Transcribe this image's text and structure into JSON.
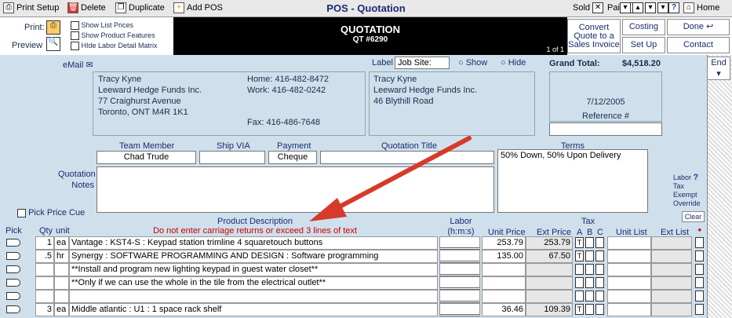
{
  "toolbar": {
    "print_setup": "Print Setup",
    "delete": "Delete",
    "duplicate": "Duplicate",
    "add_pos": "Add POS",
    "title": "POS - Quotation",
    "sold": "Sold",
    "paid": "Paid",
    "home": "Home"
  },
  "header": {
    "print": "Print:",
    "preview": "Preview",
    "show_list_prices": "Show List Prices",
    "show_product_features": "Show Product Features",
    "hide_labor": "HIde Labor Detail Matrix",
    "doc_title": "QUOTATION",
    "doc_number": "QT #6290",
    "page": "1 of 1",
    "convert": "Convert Quote to a Sales Invoice",
    "costing": "Costing",
    "done": "Done",
    "set_up": "Set Up",
    "contact": "Contact"
  },
  "info": {
    "email": "eMail",
    "label": "Label",
    "label_value": "Job Site:",
    "show": "Show",
    "hide": "Hide",
    "grand_total_label": "Grand Total:",
    "grand_total": "$4,518.20",
    "end": "End"
  },
  "bill": {
    "name": "Tracy Kyne",
    "company": "Leeward Hedge Funds Inc.",
    "street": "77 Craighurst Avenue",
    "city": "Toronto, ONT M4R 1K1",
    "home": "Home: 416-482-8472",
    "work": "Work: 416-482-0242",
    "fax": "Fax: 416-486-7648"
  },
  "ship": {
    "name": "Tracy Kyne",
    "company": "Leeward Hedge Funds Inc.",
    "street": "46 Blythill Road"
  },
  "meta": {
    "date": "7/12/2005",
    "reference": "Reference #"
  },
  "fields": {
    "team_member_label": "Team Member",
    "team_member": "Chad Trude",
    "ship_via_label": "Ship VIA",
    "payment_label": "Payment",
    "payment": "Cheque",
    "quotation_title_label": "Quotation Title",
    "terms_label": "Terms",
    "terms": "50% Down, 50% Upon Delivery",
    "notes_label1": "Quotation",
    "notes_label2": "Notes"
  },
  "labor_side": {
    "labor": "Labor",
    "tax": "Tax",
    "exempt": "Exempt",
    "override": "Override",
    "clear": "Clear"
  },
  "columns": {
    "pick_price_cue": "Pick Price Cue",
    "pick": "Pick",
    "qty": "Qty",
    "unit": "unit",
    "desc": "Product Description",
    "desc_warning": "Do not enter carriage returns or exceed 3 lines of text",
    "labor": "Labor",
    "labor_sub": "(h:m:s)",
    "unit_price": "Unit Price",
    "ext_price": "Ext Price",
    "tax": "Tax",
    "a": "A",
    "b": "B",
    "c": "C",
    "unit_list": "Unit List",
    "ext_list": "Ext List"
  },
  "rows": [
    {
      "qty": "1",
      "unit": "ea",
      "desc": "Vantage : KST4-S : Keypad station trimline 4 squaretouch buttons",
      "unit_price": "253.79",
      "ext_price": "253.79",
      "tax_a": "T"
    },
    {
      "qty": ".5",
      "unit": "hr",
      "desc": "Synergy : SOFTWARE PROGRAMMING AND DESIGN : Software programming",
      "unit_price": "135.00",
      "ext_price": "67.50",
      "tax_a": "T"
    },
    {
      "qty": "",
      "unit": "",
      "desc": "**Install and program new lighting keypad in guest water closet**",
      "unit_price": "",
      "ext_price": "",
      "tax_a": ""
    },
    {
      "qty": "",
      "unit": "",
      "desc": "**Only if we can use the whole in the tile from the electrical outlet**",
      "unit_price": "",
      "ext_price": "",
      "tax_a": ""
    },
    {
      "qty": "",
      "unit": "",
      "desc": "",
      "unit_price": "",
      "ext_price": "",
      "tax_a": ""
    },
    {
      "qty": "3",
      "unit": "ea",
      "desc": "Middle atlantic : U1 : 1 space rack shelf",
      "unit_price": "36.46",
      "ext_price": "109.39",
      "tax_a": "T"
    }
  ]
}
